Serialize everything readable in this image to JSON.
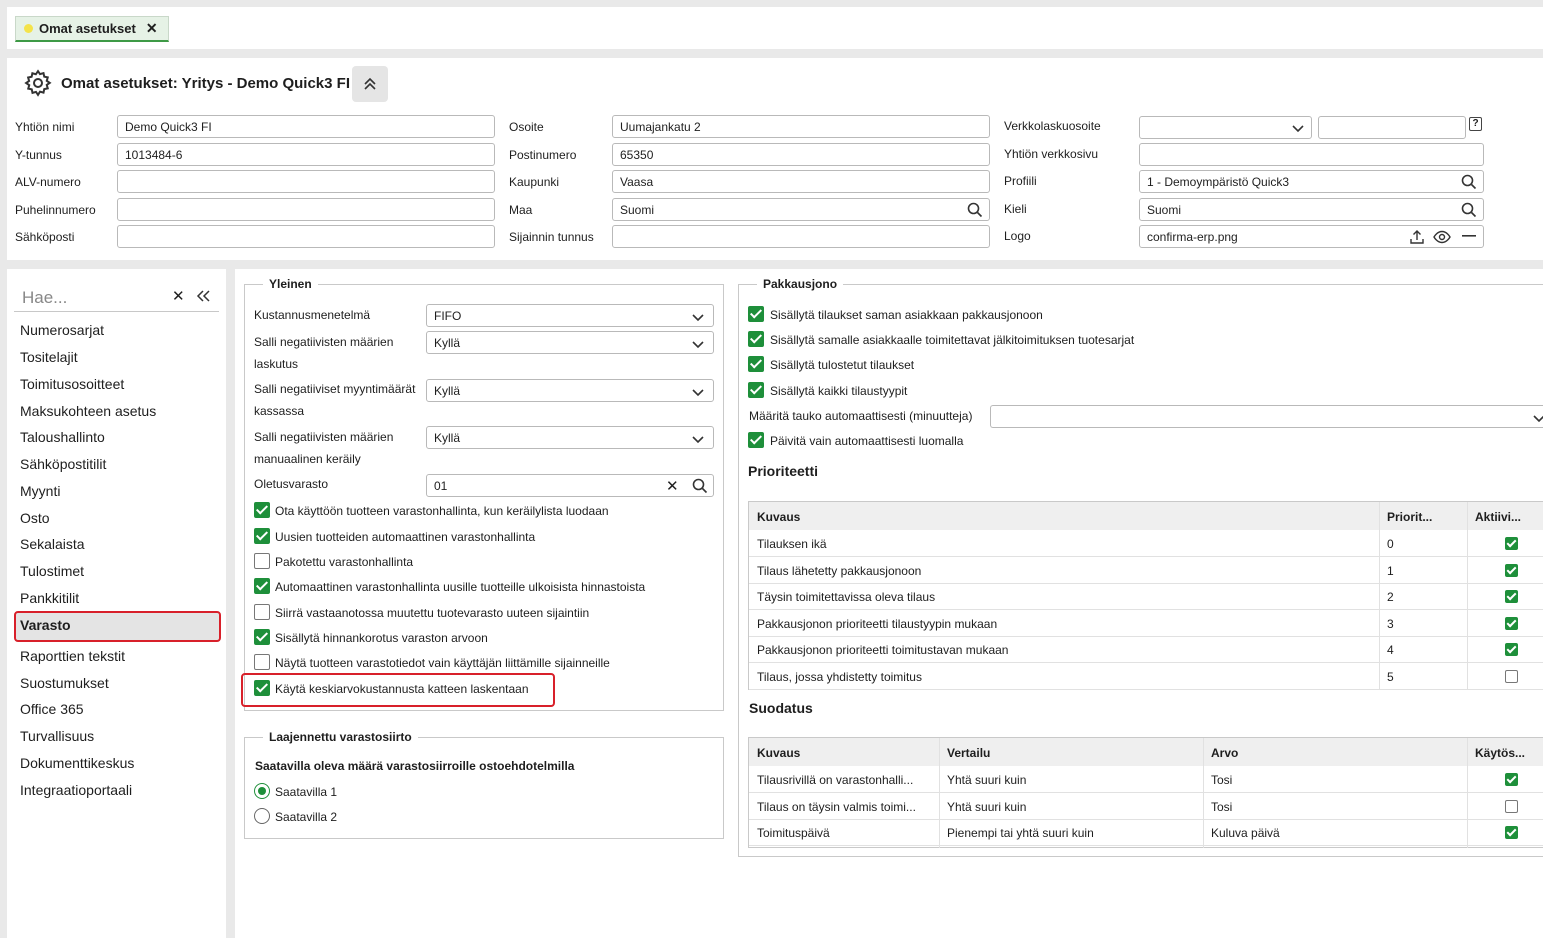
{
  "tab": {
    "label": "Omat asetukset"
  },
  "header": {
    "title": "Omat asetukset: Yritys - Demo Quick3 FI",
    "fields": {
      "company_name": {
        "label": "Yhtiön nimi",
        "value": "Demo Quick3 FI"
      },
      "business_id": {
        "label": "Y-tunnus",
        "value": "1013484-6"
      },
      "vat_number": {
        "label": "ALV-numero",
        "value": ""
      },
      "phone": {
        "label": "Puhelinnumero",
        "value": ""
      },
      "email": {
        "label": "Sähköposti",
        "value": ""
      },
      "address": {
        "label": "Osoite",
        "value": "Uumajankatu 2"
      },
      "postal_code": {
        "label": "Postinumero",
        "value": "65350"
      },
      "city": {
        "label": "Kaupunki",
        "value": "Vaasa"
      },
      "country": {
        "label": "Maa",
        "value": "Suomi"
      },
      "location_id": {
        "label": "Sijainnin tunnus",
        "value": ""
      },
      "einvoice_address": {
        "label": "Verkkolaskuosoite",
        "value": ""
      },
      "website": {
        "label": "Yhtiön verkkosivu",
        "value": ""
      },
      "profile": {
        "label": "Profiili",
        "value": "1 - Demoympäristö Quick3"
      },
      "language": {
        "label": "Kieli",
        "value": "Suomi"
      },
      "logo": {
        "label": "Logo",
        "value": "confirma-erp.png"
      }
    }
  },
  "sidebar": {
    "search_placeholder": "Hae...",
    "items": [
      "Numerosarjat",
      "Tositelajit",
      "Toimitusosoitteet",
      "Maksukohteen asetus",
      "Taloushallinto",
      "Sähköpostitilit",
      "Myynti",
      "Osto",
      "Sekalaista",
      "Tulostimet",
      "Pankkitilit",
      "Varasto",
      "Raporttien tekstit",
      "Suostumukset",
      "Office 365",
      "Turvallisuus",
      "Dokumenttikeskus",
      "Integraatioportaali"
    ],
    "active_index": 11
  },
  "general": {
    "legend": "Yleinen",
    "cost_method": {
      "label": "Kustannusmenetelmä",
      "value": "FIFO"
    },
    "neg_invoice": {
      "label1": "Salli negatiivisten määrien",
      "label2": "laskutus",
      "value": "Kyllä"
    },
    "neg_cash": {
      "label1": "Salli negatiiviset myyntimäärät",
      "label2": "kassassa",
      "value": "Kyllä"
    },
    "neg_manual": {
      "label1": "Salli negatiivisten määrien",
      "label2": "manuaalinen keräily",
      "value": "Kyllä"
    },
    "default_wh": {
      "label": "Oletusvarasto",
      "value": "01"
    },
    "checks": [
      {
        "label": "Ota käyttöön tuotteen varastonhallinta, kun keräilylista luodaan",
        "checked": true
      },
      {
        "label": "Uusien tuotteiden automaattinen varastonhallinta",
        "checked": true
      },
      {
        "label": "Pakotettu varastonhallinta",
        "checked": false
      },
      {
        "label": "Automaattinen varastonhallinta uusille tuotteille ulkoisista hinnastoista",
        "checked": true
      },
      {
        "label": "Siirrä vastaanotossa muutettu tuotevarasto uuteen sijaintiin",
        "checked": false
      },
      {
        "label": "Sisällytä hinnankorotus varaston arvoon",
        "checked": true
      },
      {
        "label": "Näytä tuotteen varastotiedot vain käyttäjän liittämille sijainneille",
        "checked": false
      },
      {
        "label": "Käytä keskiarvokustannusta katteen laskentaan",
        "checked": true
      }
    ]
  },
  "extended": {
    "legend": "Laajennettu varastosiirto",
    "heading": "Saatavilla oleva määrä varastosiirroille ostoehdotelmilla",
    "options": [
      {
        "label": "Saatavilla 1",
        "selected": true
      },
      {
        "label": "Saatavilla 2",
        "selected": false
      }
    ]
  },
  "packing": {
    "legend": "Pakkausjono",
    "checks": [
      {
        "label": "Sisällytä tilaukset saman asiakkaan pakkausjonoon",
        "checked": true
      },
      {
        "label": "Sisällytä samalle asiakkaalle toimitettavat jälkitoimituksen tuotesarjat",
        "checked": true
      },
      {
        "label": "Sisällytä tulostetut tilaukset",
        "checked": true
      },
      {
        "label": "Sisällytä kaikki tilaustyypit",
        "checked": true
      }
    ],
    "pause_label": "Määritä tauko automaattisesti (minuutteja)",
    "pause_value": "",
    "auto_update": {
      "label": "Päivitä vain automaattisesti luomalla",
      "checked": true
    }
  },
  "priority": {
    "title": "Prioriteetti",
    "headers": [
      "Kuvaus",
      "Priorit...",
      "Aktiivi..."
    ],
    "rows": [
      {
        "desc": "Tilauksen ikä",
        "prio": "0",
        "active": true
      },
      {
        "desc": "Tilaus lähetetty pakkausjonoon",
        "prio": "1",
        "active": true
      },
      {
        "desc": "Täysin toimitettavissa oleva tilaus",
        "prio": "2",
        "active": true
      },
      {
        "desc": "Pakkausjonon prioriteetti tilaustyypin mukaan",
        "prio": "3",
        "active": true
      },
      {
        "desc": "Pakkausjonon prioriteetti toimitustavan mukaan",
        "prio": "4",
        "active": true
      },
      {
        "desc": "Tilaus, jossa yhdistetty toimitus",
        "prio": "5",
        "active": false
      }
    ]
  },
  "filter": {
    "title": "Suodatus",
    "headers": [
      "Kuvaus",
      "Vertailu",
      "Arvo",
      "Käytös..."
    ],
    "rows": [
      {
        "desc": "Tilausrivillä on varastonhalli...",
        "cmp": "Yhtä suuri kuin",
        "val": "Tosi",
        "used": true
      },
      {
        "desc": "Tilaus on täysin valmis toimi...",
        "cmp": "Yhtä suuri kuin",
        "val": "Tosi",
        "used": false
      },
      {
        "desc": "Toimituspäivä",
        "cmp": "Pienempi tai yhtä suuri kuin",
        "val": "Kuluva päivä",
        "used": true
      }
    ]
  }
}
